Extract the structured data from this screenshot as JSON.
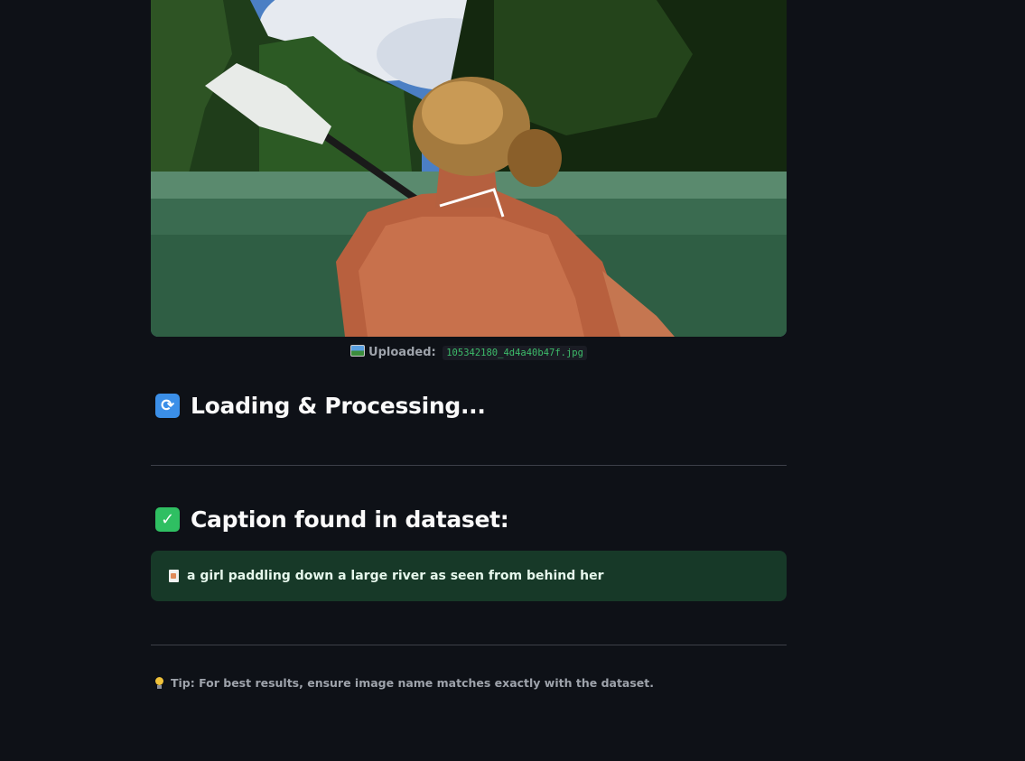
{
  "uploaded": {
    "label": "Uploaded:",
    "filename": "105342180_4d4a40b47f.jpg"
  },
  "loading": {
    "heading": "Loading & Processing...",
    "icon": "arrows-cycle-icon"
  },
  "caption": {
    "heading": "Caption found in dataset:",
    "icon": "check-mark-icon",
    "text": "a girl paddling down a large river as seen from behind her",
    "text_icon": "page-icon"
  },
  "tip": {
    "text": "Tip: For best results, ensure image name matches exactly with the dataset.",
    "icon": "light-bulb-icon"
  },
  "colors": {
    "background": "#0e1117",
    "success_box": "#173928",
    "code_green": "#3dbb6a"
  }
}
